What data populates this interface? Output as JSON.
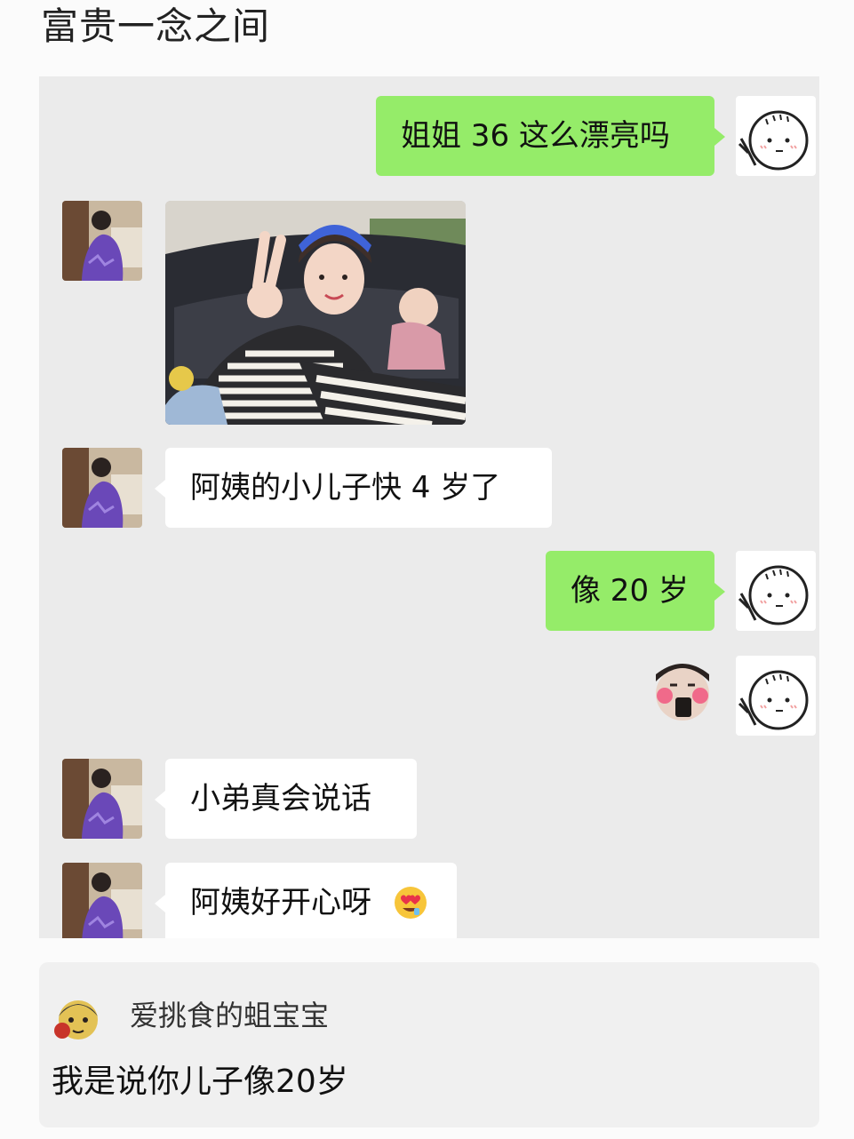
{
  "page": {
    "title": "富贵一念之间"
  },
  "messages": [
    {
      "side": "me",
      "text": "姐姐 36 这么漂亮吗"
    },
    {
      "side": "them",
      "type": "image",
      "text": ""
    },
    {
      "side": "them",
      "text": "阿姨的小儿子快 4 岁了"
    },
    {
      "side": "me",
      "text": "像 20 岁"
    },
    {
      "side": "me",
      "type": "sticker",
      "text": ""
    },
    {
      "side": "them",
      "text": "小弟真会说话"
    },
    {
      "side": "them",
      "text": "阿姨好开心呀",
      "emoji": "heart-eyes-emoji"
    }
  ],
  "comment": {
    "username": "爱挑食的蛆宝宝",
    "text": "我是说你儿子像20岁"
  },
  "colors": {
    "chat_background": "#ebebeb",
    "my_bubble": "#95ec69",
    "their_bubble": "#ffffff"
  }
}
